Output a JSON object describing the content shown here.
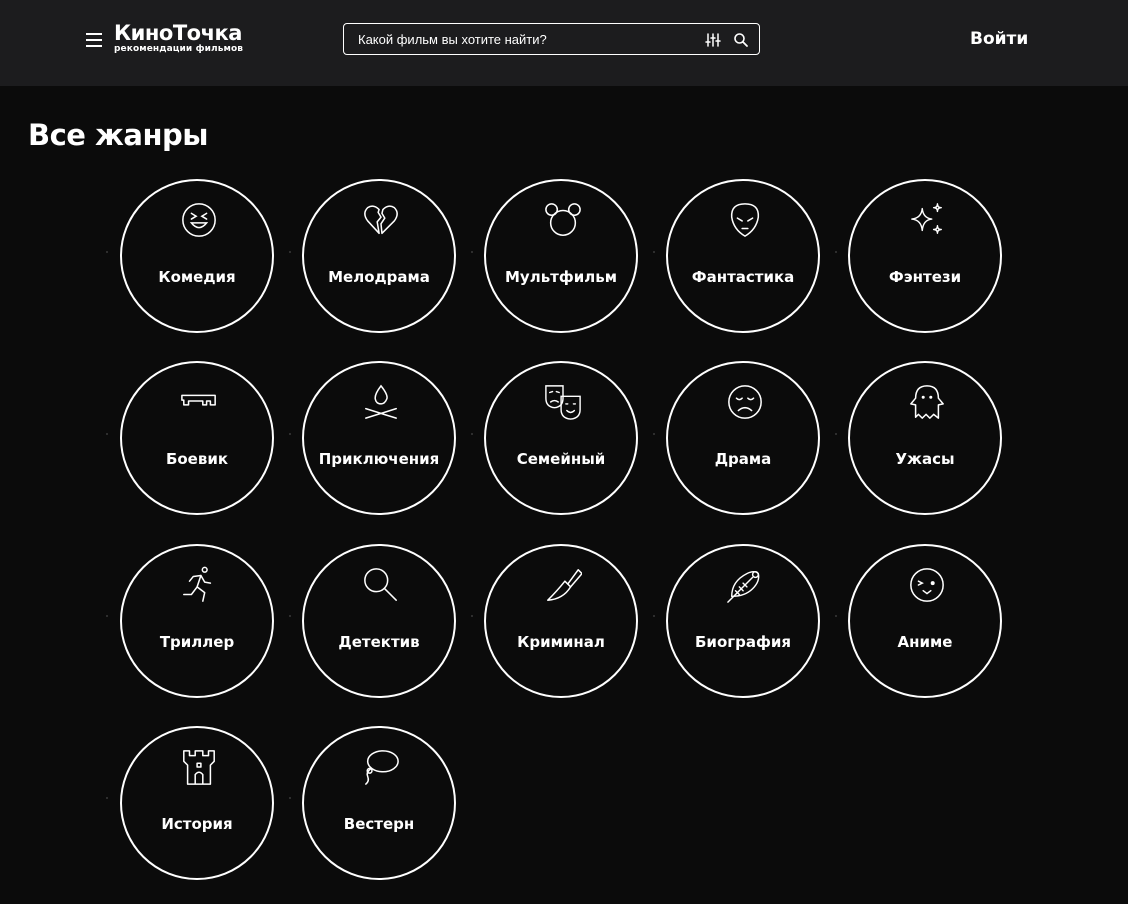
{
  "header": {
    "logo_title": "КиноТочка",
    "logo_subtitle": "рекомендации фильмов",
    "search_placeholder": "Какой фильм вы хотите найти?",
    "login_label": "Войти",
    "menu_icon": "hamburger-menu-icon",
    "filter_icon": "filter-sliders-icon",
    "search_icon": "search-icon"
  },
  "page_title": "Все жанры",
  "genres": [
    {
      "label": "Комедия",
      "icon": "laughing-face-icon"
    },
    {
      "label": "Мелодрама",
      "icon": "broken-heart-icon"
    },
    {
      "label": "Мультфильм",
      "icon": "cartoon-mouse-icon"
    },
    {
      "label": "Фантастика",
      "icon": "alien-icon"
    },
    {
      "label": "Фэнтези",
      "icon": "sparkles-icon"
    },
    {
      "label": "Боевик",
      "icon": "gun-icon"
    },
    {
      "label": "Приключения",
      "icon": "campfire-icon"
    },
    {
      "label": "Семейный",
      "icon": "theater-masks-icon"
    },
    {
      "label": "Драма",
      "icon": "sad-face-icon"
    },
    {
      "label": "Ужасы",
      "icon": "ghost-icon"
    },
    {
      "label": "Триллер",
      "icon": "running-man-icon"
    },
    {
      "label": "Детектив",
      "icon": "magnifier-icon"
    },
    {
      "label": "Криминал",
      "icon": "knife-icon"
    },
    {
      "label": "Биография",
      "icon": "feather-quill-icon"
    },
    {
      "label": "Аниме",
      "icon": "anime-face-icon"
    },
    {
      "label": "История",
      "icon": "castle-tower-icon"
    },
    {
      "label": "Вестерн",
      "icon": "lasso-icon"
    }
  ],
  "colors": {
    "background": "#0b0b0b",
    "header": "#1c1c1e",
    "text": "#ffffff"
  }
}
